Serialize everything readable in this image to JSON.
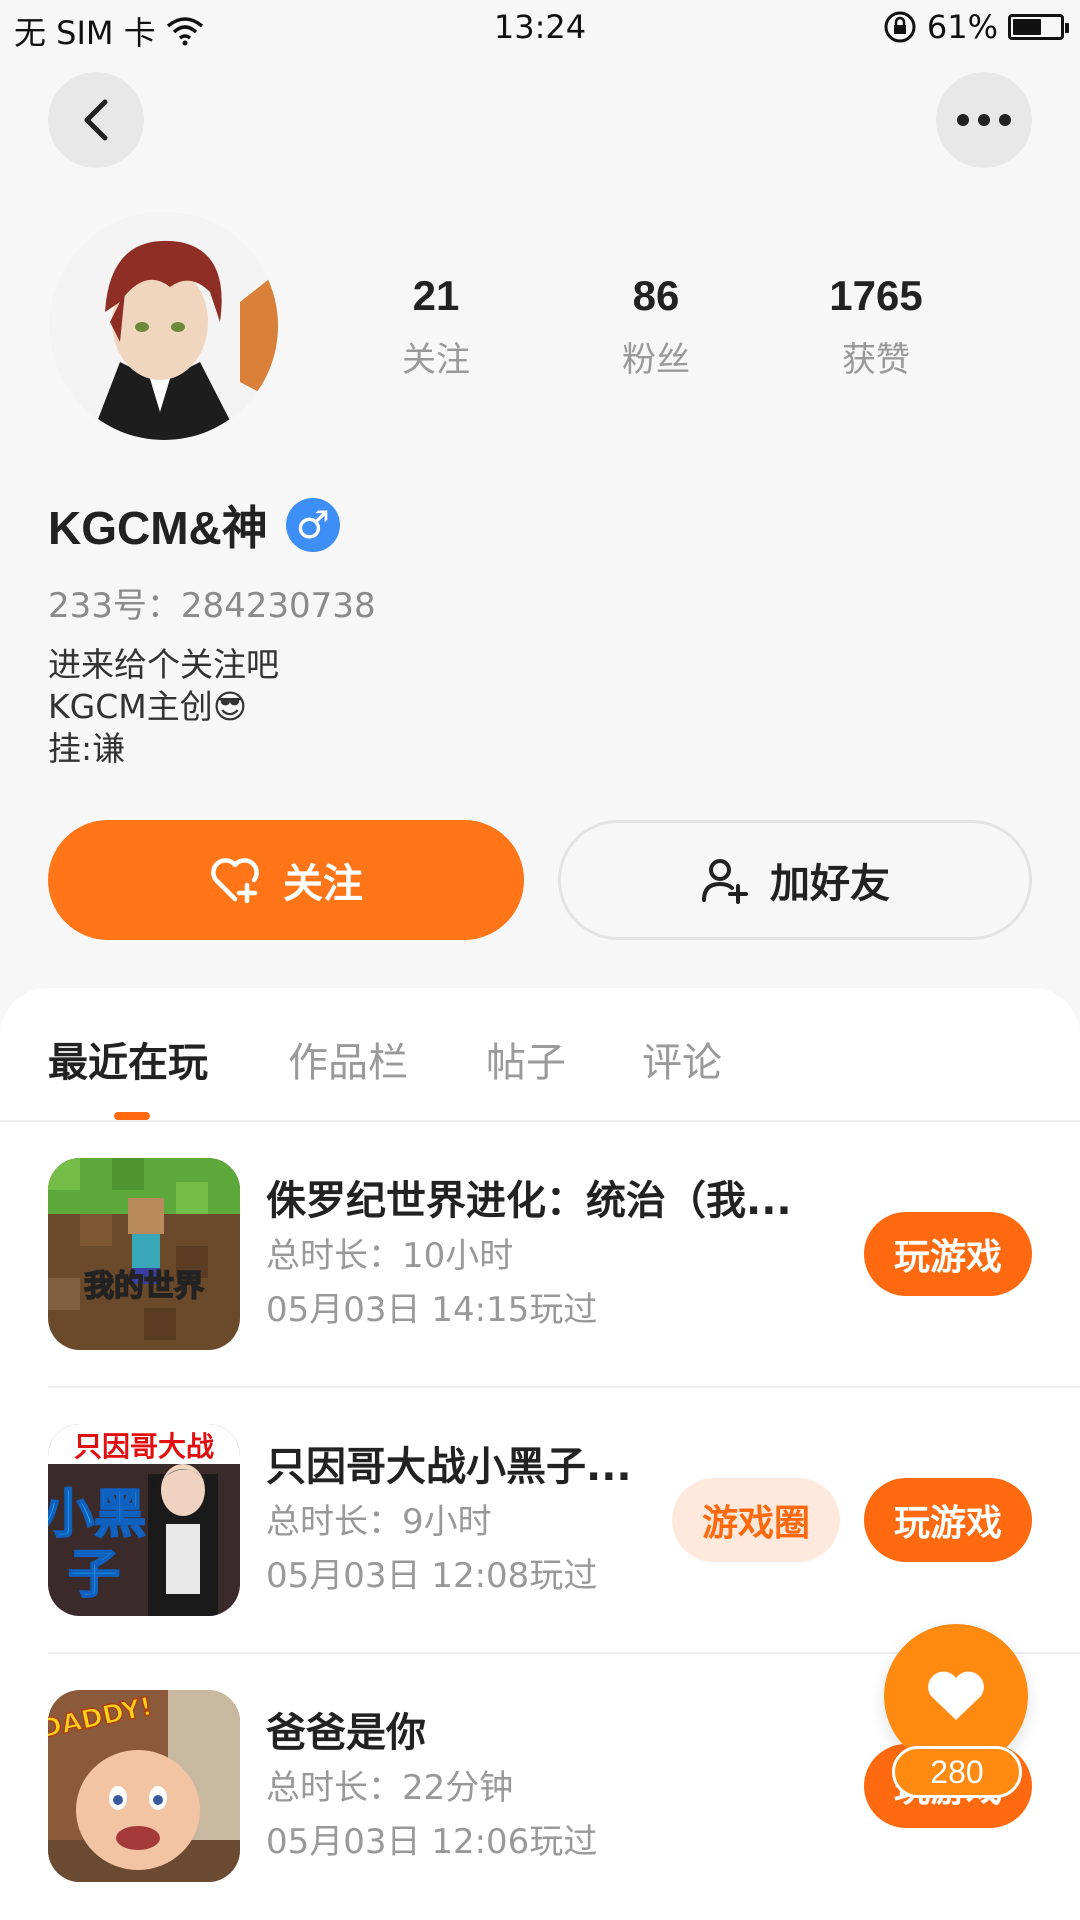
{
  "status_bar": {
    "carrier": "无 SIM 卡",
    "time": "13:24",
    "battery": "61%",
    "battery_level": 0.61
  },
  "profile": {
    "stats": [
      {
        "value": "21",
        "label": "关注"
      },
      {
        "value": "86",
        "label": "粉丝"
      },
      {
        "value": "1765",
        "label": "获赞"
      }
    ],
    "username": "KGCM&神",
    "gender": "♂",
    "user_id": "233号：284230738",
    "bio_lines": [
      "进来给个关注吧",
      "KGCM主创😎",
      "挂:谦"
    ]
  },
  "actions": {
    "follow_label": "关注",
    "add_friend_label": "加好友"
  },
  "tabs": [
    {
      "label": "最近在玩",
      "active": true
    },
    {
      "label": "作品栏",
      "active": false
    },
    {
      "label": "帖子",
      "active": false
    },
    {
      "label": "评论",
      "active": false
    }
  ],
  "games": [
    {
      "title": "侏罗纪世界进化：统治（我...",
      "duration": "总时长：10小时",
      "last_played": "05月03日 14:15玩过",
      "icon_text": "我的世界",
      "play_label": "玩游戏"
    },
    {
      "title": "只因哥大战小黑子...",
      "duration": "总时长：9小时",
      "last_played": "05月03日 12:08玩过",
      "icon_text_top": "只因哥大战",
      "icon_text_big": "小黑子",
      "circle_label": "游戏圈",
      "play_label": "玩游戏"
    },
    {
      "title": "爸爸是你",
      "duration": "总时长：22分钟",
      "last_played": "05月03日 12:06玩过",
      "icon_text": "DADDY!",
      "play_label": "玩游戏"
    }
  ],
  "floating_like": {
    "count": "280"
  },
  "colors": {
    "accent": "#ff6a10",
    "gender_badge": "#3d8ef5"
  }
}
